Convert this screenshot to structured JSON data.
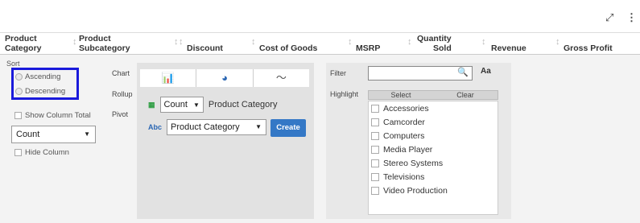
{
  "toolbar": {
    "expand_icon": "expand-icon",
    "more_icon": "more-vertical-icon"
  },
  "columns": [
    {
      "line1": "Product",
      "line2": "Category"
    },
    {
      "line1": "Product",
      "line2": "Subcategory"
    },
    {
      "line1": "",
      "line2": "Discount"
    },
    {
      "line1": "",
      "line2": "Cost of Goods"
    },
    {
      "line1": "",
      "line2": "MSRP"
    },
    {
      "line1": "Quantity",
      "line2": "Sold"
    },
    {
      "line1": "",
      "line2": "Revenue"
    },
    {
      "line1": "",
      "line2": "Gross Profit"
    }
  ],
  "sort_panel": {
    "title": "Sort",
    "ascending": "Ascending",
    "descending": "Descending",
    "show_column_total": "Show Column Total",
    "aggregation": "Count",
    "hide_column": "Hide Column"
  },
  "tabs": [
    "Chart",
    "Rollup",
    "Pivot"
  ],
  "chart_config": {
    "icons": [
      "bar-chart-icon",
      "pie-chart-icon",
      "line-chart-icon"
    ],
    "measure": "Count",
    "measure_label": "Product Category",
    "dimension": "Product Category",
    "create_label": "Create"
  },
  "filter_panel": {
    "filter_label": "Filter",
    "filter_value": "",
    "case_label": "Aa",
    "highlight_label": "Highlight",
    "select_label": "Select",
    "clear_label": "Clear",
    "items": [
      "Accessories",
      "Camcorder",
      "Computers",
      "Media Player",
      "Stereo Systems",
      "Televisions",
      "Video Production"
    ]
  }
}
